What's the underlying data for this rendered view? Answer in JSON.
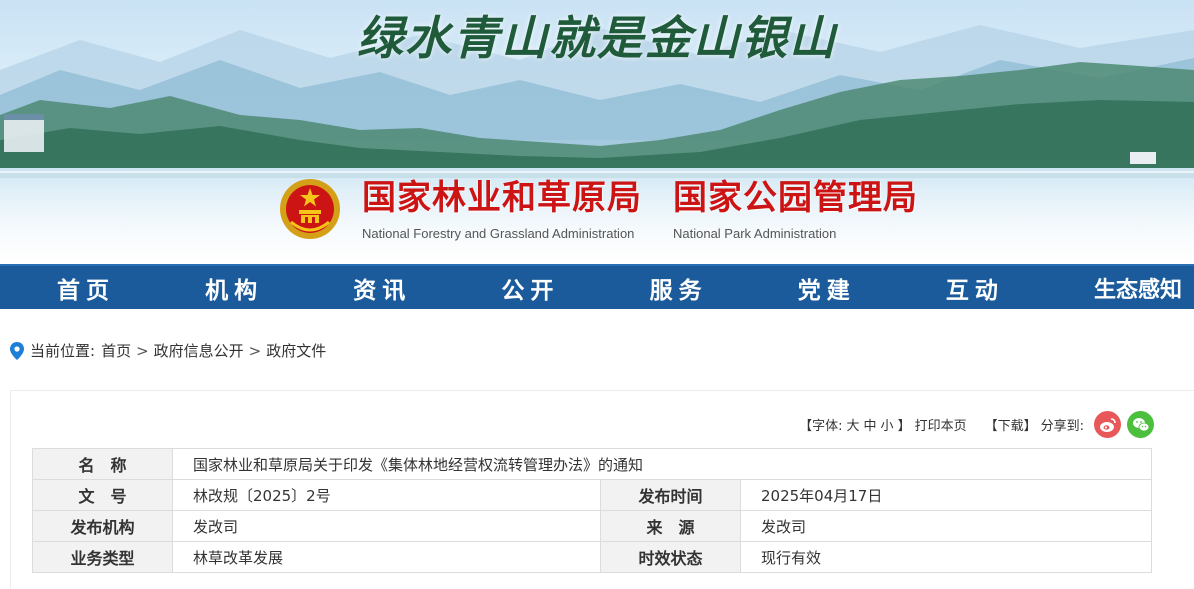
{
  "banner": {
    "slogan": "绿水青山就是金山银山",
    "org_cn_1": "国家林业和草原局",
    "org_en_1": "National Forestry and Grassland Administration",
    "org_cn_2": "国家公园管理局",
    "org_en_2": "National  Park  Administration",
    "emblem_icon": "national-emblem-icon"
  },
  "nav": {
    "items": [
      "首页",
      "机构",
      "资讯",
      "公开",
      "服务",
      "党建",
      "互动",
      "生态感知"
    ]
  },
  "breadcrumb": {
    "prefix": "当前位置:",
    "items": [
      "首页",
      "政府信息公开",
      "政府文件"
    ],
    "separator": ">"
  },
  "tools": {
    "font_label": "【字体:",
    "size_large": "大",
    "size_medium": "中",
    "size_small": "小",
    "font_close": "】",
    "print": "打印本页",
    "download": "【下载】",
    "share": "分享到:",
    "weibo_icon": "weibo-icon",
    "wechat_icon": "wechat-icon"
  },
  "meta": {
    "name_label": "名　称",
    "name_value": "国家林业和草原局关于印发《集体林地经营权流转管理办法》的通知",
    "doc_no_label": "文　号",
    "doc_no_value": "林改规〔2025〕2号",
    "publish_time_label": "发布时间",
    "publish_time_value": "2025年04月17日",
    "issuer_label": "发布机构",
    "issuer_value": "发改司",
    "source_label": "来　源",
    "source_value": "发改司",
    "biz_type_label": "业务类型",
    "biz_type_value": "林草改革发展",
    "status_label": "时效状态",
    "status_value": "现行有效"
  },
  "colors": {
    "nav_bg": "#1b5b9c",
    "org_red": "#cc1414",
    "weibo": "#e8585a",
    "wechat": "#4cbf3c"
  }
}
